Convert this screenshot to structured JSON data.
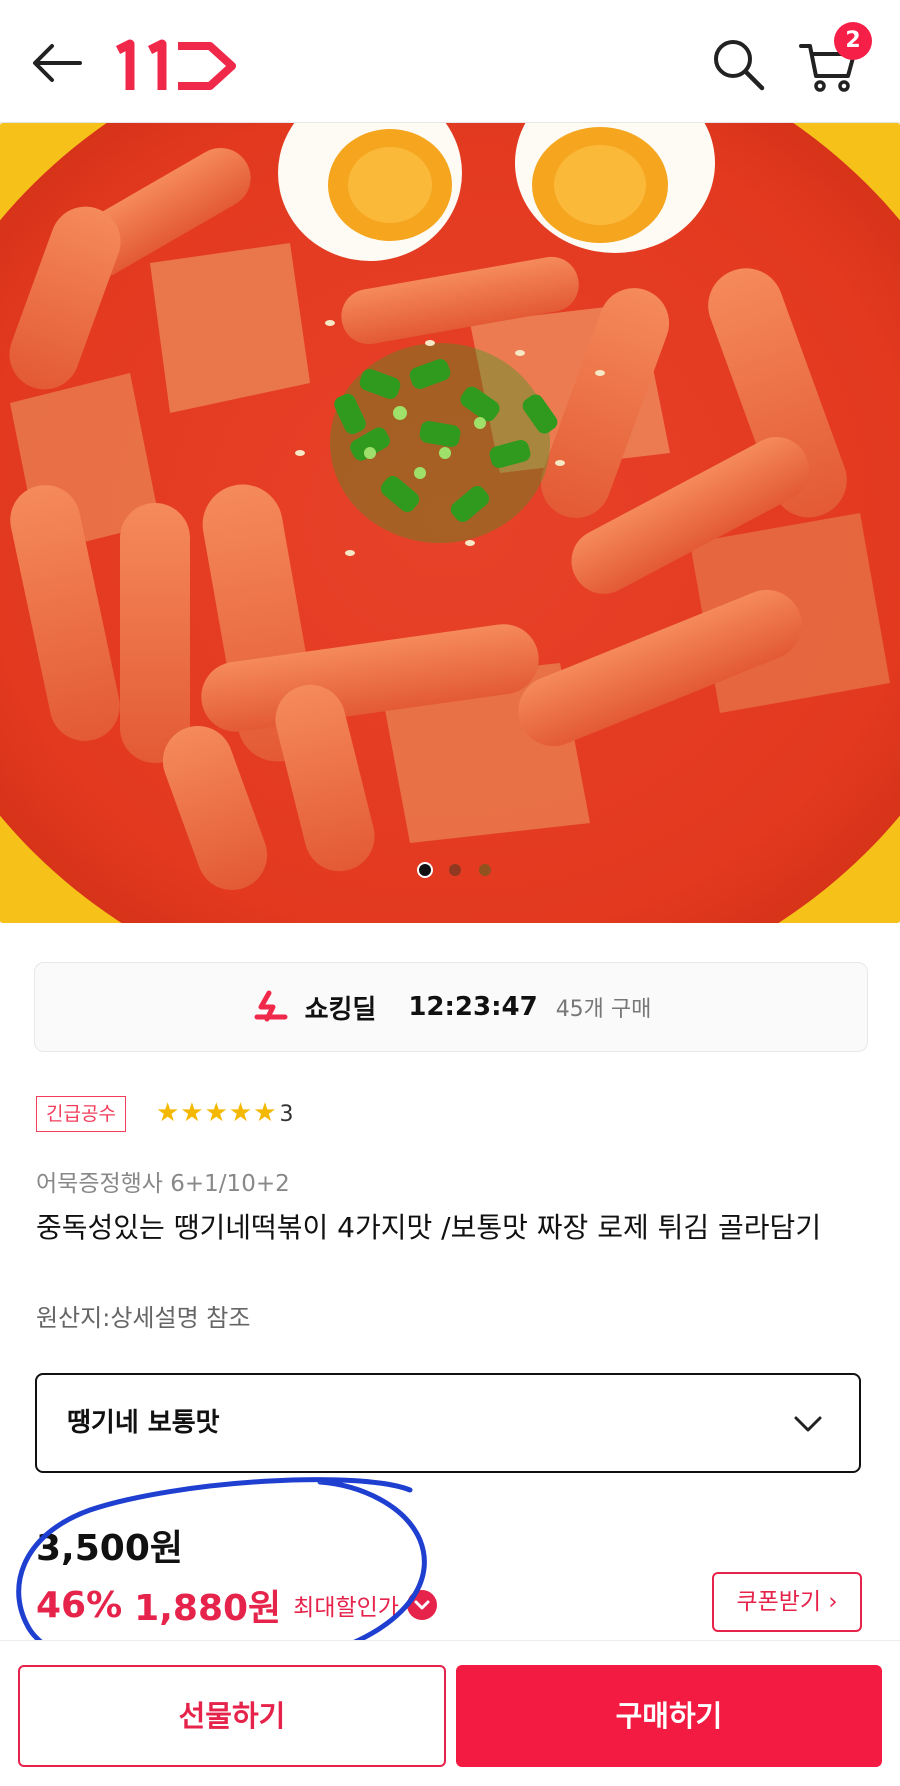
{
  "header": {
    "logo_text": "11",
    "cart_count": "2",
    "icons": [
      "back-arrow-icon",
      "search-icon",
      "cart-icon"
    ]
  },
  "gallery": {
    "image_subject": "tteokbokki",
    "slide_total": 3,
    "slide_current": 1
  },
  "deal": {
    "label": "쇼킹딜",
    "timer": "12:23:47",
    "purchases": "45개 구매"
  },
  "product": {
    "tag": "긴급공수",
    "rating_stars": 5,
    "review_count": "3",
    "promo": "어묵증정행사 6+1/10+2",
    "title": "중독성있는 땡기네떡볶이 4가지맛 /보통맛 짜장 로제 튀김 골라담기",
    "origin": "원산지:상세설명 참조"
  },
  "option": {
    "selected": "땡기네 보통맛"
  },
  "price": {
    "original": "3,500원",
    "discount_pct": "46%",
    "sale": "1,880원",
    "max_label": "최대할인가",
    "coupon_button": "쿠폰받기"
  },
  "actions": {
    "gift": "선물하기",
    "buy": "구매하기"
  },
  "colors": {
    "brand": "#f31b41",
    "accent_text": "#e6234a",
    "star": "#f5b800",
    "annotation": "#1e3fd0"
  }
}
